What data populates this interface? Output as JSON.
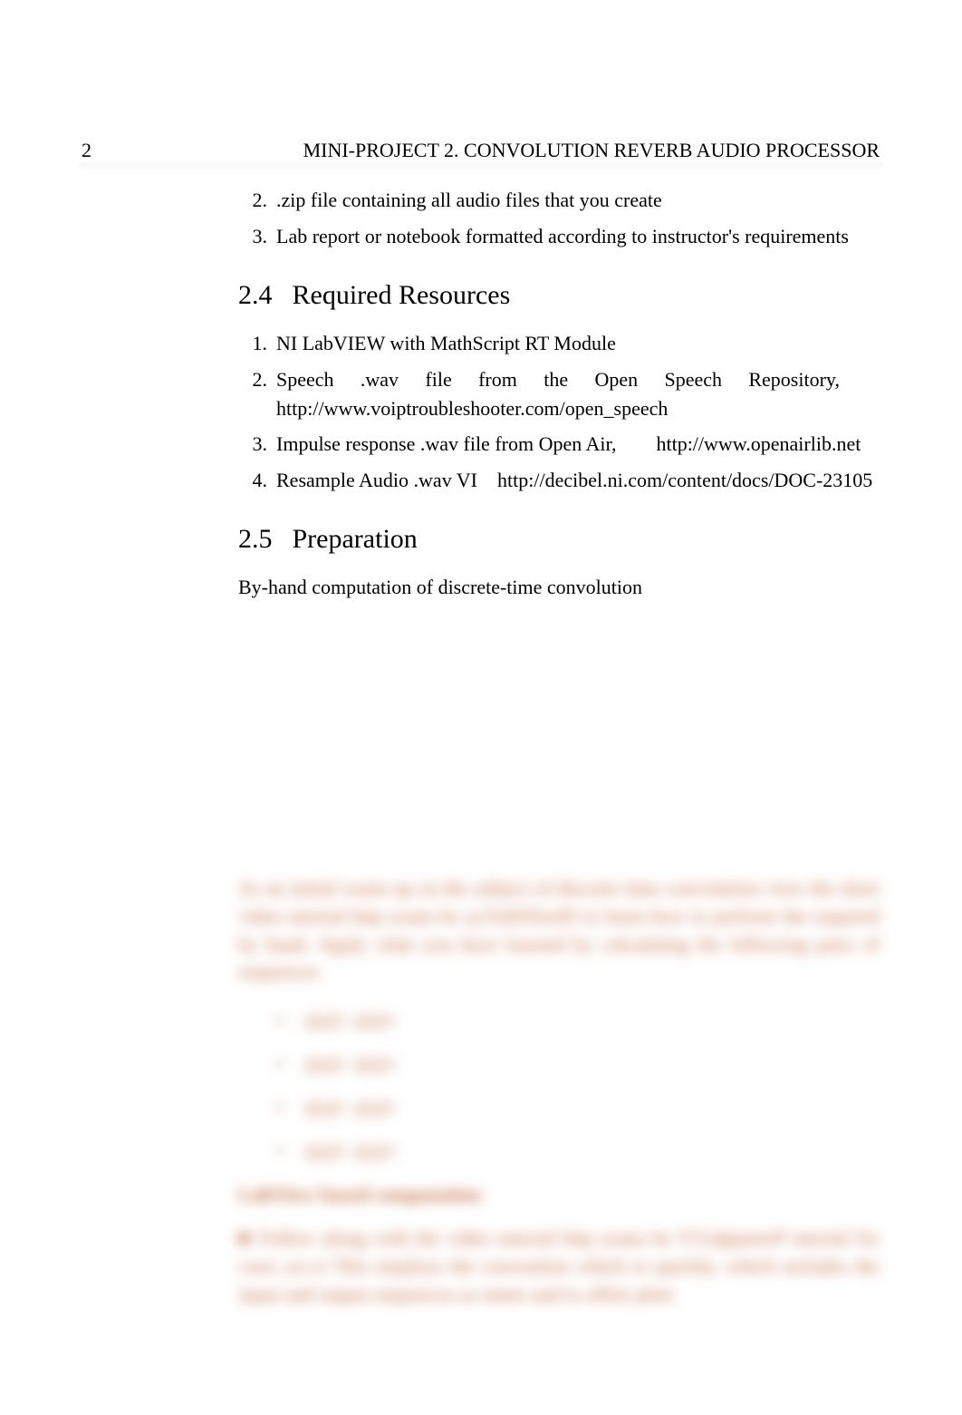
{
  "page_number": "2",
  "running_header": "MINI-PROJECT 2. CONVOLUTION REVERB AUDIO PROCESSOR",
  "top_list": [
    {
      "num": "2.",
      "text": ".zip file containing all audio files that you create"
    },
    {
      "num": "3.",
      "text": "Lab report or notebook formatted according to instructor's requirements"
    }
  ],
  "section_24": {
    "number": "2.4",
    "title": "Required Resources",
    "items": [
      {
        "num": "1.",
        "text": "NI LabVIEW with MathScript RT Module"
      },
      {
        "num": "2.",
        "text": "Speech .wav file from the Open Speech Repository,  http://www.voiptroubleshooter.com/open_speech"
      },
      {
        "num": "3.",
        "text": "Impulse response .wav file from Open Air,  http://www.openairlib.net"
      },
      {
        "num": "4.",
        "text": "Resample Audio .wav VI http://decibel.ni.com/content/docs/DOC-23105"
      }
    ]
  },
  "section_25": {
    "number": "2.5",
    "title": "Preparation",
    "intro": "By-hand computation of discrete-time convolution"
  },
  "blurred": {
    "para1": "As an initial warm up on the subject of discrete time convolution view the short video tutorial http youtu be yyTu0SXeeEI to learn how to perform the required by hand. Apply what you have learned by calculating the following pairs of sequences",
    "items": [
      "x[n]=  x[n]=",
      "x[n]=       x[n]=",
      "x[n]=       x[n]=",
      "x[n]=  x[n]="
    ],
    "heading": "LabView based computation",
    "para2": "■  Follow along with the video tutorial http youtu be YYsdppsteeP tutorial for conv_ex.vi This employs the convention which to quickly, which includes the input and output sequences as stems and to offset plots"
  }
}
